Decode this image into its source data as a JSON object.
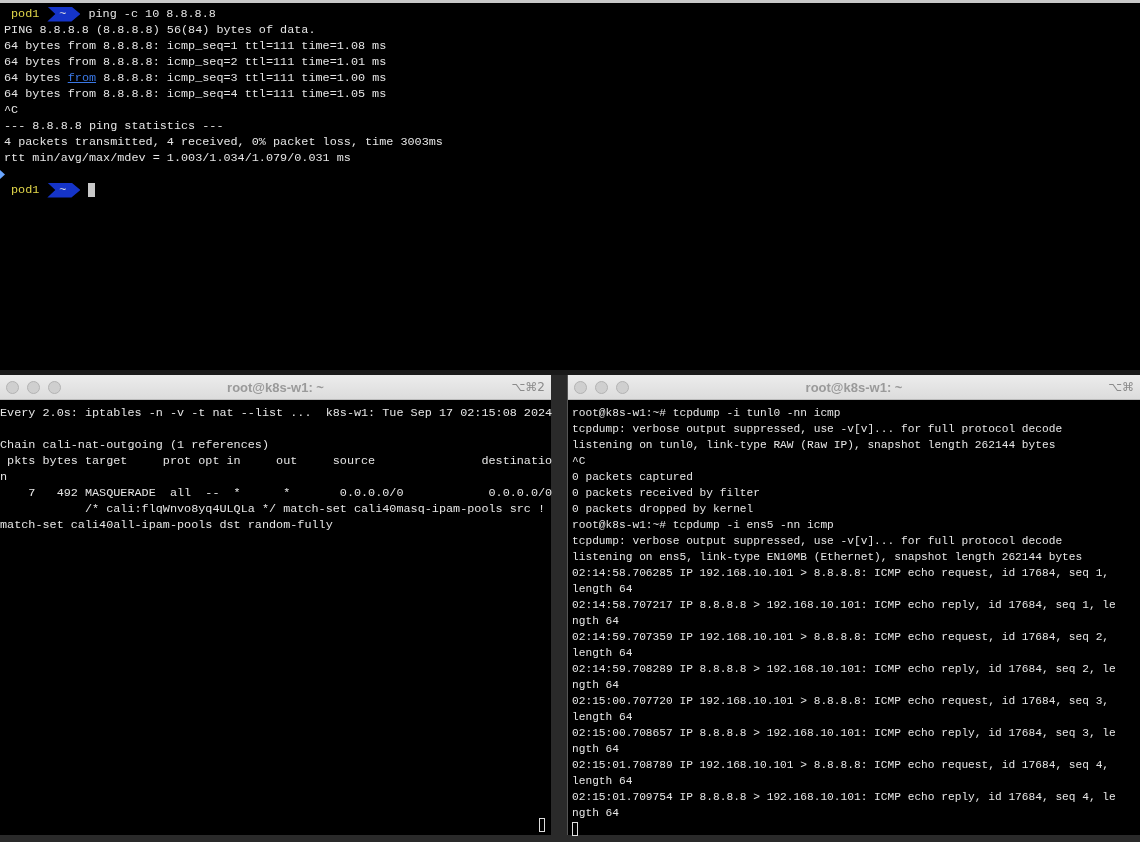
{
  "top_terminal": {
    "lines": [
      {
        "kind": "prompt",
        "host": "pod1",
        "dir": "~",
        "command": "ping -c 10 8.8.8.8",
        "cursor": false
      },
      {
        "kind": "text",
        "text": "PING 8.8.8.8 (8.8.8.8) 56(84) bytes of data."
      },
      {
        "kind": "text",
        "text": "64 bytes from 8.8.8.8: icmp_seq=1 ttl=111 time=1.08 ms"
      },
      {
        "kind": "text",
        "text": "64 bytes from 8.8.8.8: icmp_seq=2 ttl=111 time=1.01 ms"
      },
      {
        "kind": "link",
        "before": "64 bytes ",
        "link": "from",
        "after": " 8.8.8.8: icmp_seq=3 ttl=111 time=1.00 ms"
      },
      {
        "kind": "text",
        "text": "64 bytes from 8.8.8.8: icmp_seq=4 ttl=111 time=1.05 ms"
      },
      {
        "kind": "text",
        "text": "^C"
      },
      {
        "kind": "text",
        "text": "--- 8.8.8.8 ping statistics ---"
      },
      {
        "kind": "text",
        "text": "4 packets transmitted, 4 received, 0% packet loss, time 3003ms"
      },
      {
        "kind": "text",
        "text": "rtt min/avg/max/mdev = 1.003/1.034/1.079/0.031 ms"
      },
      {
        "kind": "mark"
      },
      {
        "kind": "prompt",
        "host": "pod1",
        "dir": "~",
        "cursor": true
      }
    ]
  },
  "panes": [
    {
      "title": "root@k8s-w1: ~",
      "shortcut": "⌥⌘2",
      "lines": [
        {
          "kind": "text",
          "text": "Every 2.0s: iptables -n -v -t nat --list ...  k8s-w1: Tue Sep 17 02:15:08 2024"
        },
        {
          "kind": "blank"
        },
        {
          "kind": "text",
          "text": "Chain cali-nat-outgoing (1 references)"
        },
        {
          "kind": "text",
          "text": " pkts bytes target     prot opt in     out     source               destinatio"
        },
        {
          "kind": "text",
          "text": "n"
        },
        {
          "kind": "text",
          "text": "    7   492 MASQUERADE  all  --  *      *       0.0.0.0/0            0.0.0.0/0"
        },
        {
          "kind": "text",
          "text": "            /* cali:flqWnvo8yq4ULQLa */ match-set cali40masq-ipam-pools src !"
        },
        {
          "kind": "text",
          "text": "match-set cali40all-ipam-pools dst random-fully"
        },
        {
          "kind": "cursor_bottom_right"
        }
      ]
    },
    {
      "title": "root@k8s-w1: ~",
      "shortcut": "⌥⌘",
      "lines": [
        {
          "kind": "text",
          "text": "root@k8s-w1:~# tcpdump -i tunl0 -nn icmp"
        },
        {
          "kind": "text",
          "text": "tcpdump: verbose output suppressed, use -v[v]... for full protocol decode"
        },
        {
          "kind": "text",
          "text": "listening on tunl0, link-type RAW (Raw IP), snapshot length 262144 bytes"
        },
        {
          "kind": "text",
          "text": "^C"
        },
        {
          "kind": "text",
          "text": "0 packets captured"
        },
        {
          "kind": "text",
          "text": "0 packets received by filter"
        },
        {
          "kind": "text",
          "text": "0 packets dropped by kernel"
        },
        {
          "kind": "text",
          "text": "root@k8s-w1:~# tcpdump -i ens5 -nn icmp"
        },
        {
          "kind": "text",
          "text": "tcpdump: verbose output suppressed, use -v[v]... for full protocol decode"
        },
        {
          "kind": "text",
          "text": "listening on ens5, link-type EN10MB (Ethernet), snapshot length 262144 bytes"
        },
        {
          "kind": "text",
          "text": "02:14:58.706285 IP 192.168.10.101 > 8.8.8.8: ICMP echo request, id 17684, seq 1,"
        },
        {
          "kind": "text",
          "text": "length 64"
        },
        {
          "kind": "text",
          "text": "02:14:58.707217 IP 8.8.8.8 > 192.168.10.101: ICMP echo reply, id 17684, seq 1, le"
        },
        {
          "kind": "text",
          "text": "ngth 64"
        },
        {
          "kind": "text",
          "text": "02:14:59.707359 IP 192.168.10.101 > 8.8.8.8: ICMP echo request, id 17684, seq 2,"
        },
        {
          "kind": "text",
          "text": "length 64"
        },
        {
          "kind": "text",
          "text": "02:14:59.708289 IP 8.8.8.8 > 192.168.10.101: ICMP echo reply, id 17684, seq 2, le"
        },
        {
          "kind": "text",
          "text": "ngth 64"
        },
        {
          "kind": "text",
          "text": "02:15:00.707720 IP 192.168.10.101 > 8.8.8.8: ICMP echo request, id 17684, seq 3,"
        },
        {
          "kind": "text",
          "text": "length 64"
        },
        {
          "kind": "text",
          "text": "02:15:00.708657 IP 8.8.8.8 > 192.168.10.101: ICMP echo reply, id 17684, seq 3, le"
        },
        {
          "kind": "text",
          "text": "ngth 64"
        },
        {
          "kind": "text",
          "text": "02:15:01.708789 IP 192.168.10.101 > 8.8.8.8: ICMP echo request, id 17684, seq 4,"
        },
        {
          "kind": "text",
          "text": "length 64"
        },
        {
          "kind": "text",
          "text": "02:15:01.709754 IP 8.8.8.8 > 192.168.10.101: ICMP echo reply, id 17684, seq 4, le"
        },
        {
          "kind": "text",
          "text": "ngth 64"
        },
        {
          "kind": "cursor"
        }
      ]
    }
  ]
}
